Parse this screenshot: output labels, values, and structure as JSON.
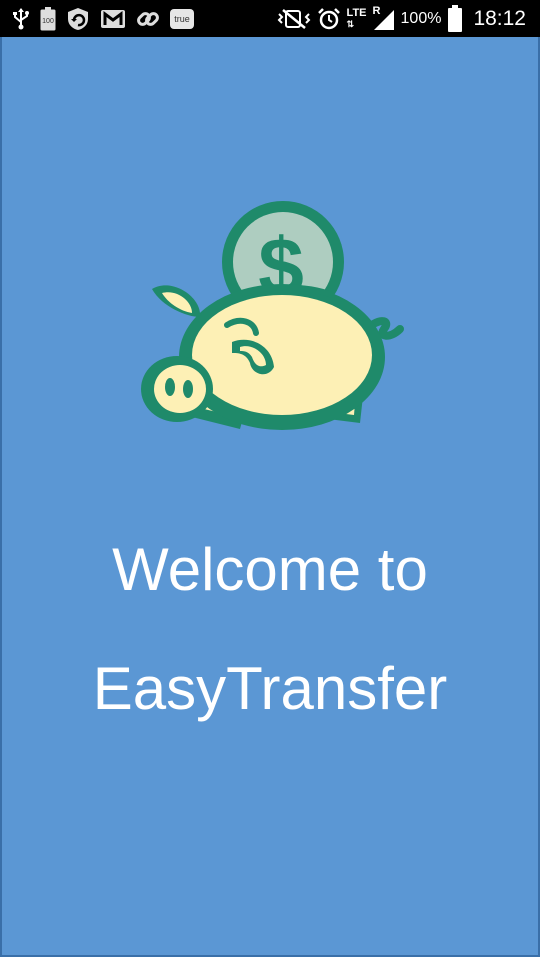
{
  "status_bar": {
    "left_icons": [
      "usb-icon",
      "battery-100-notification-icon",
      "shield-refresh-icon",
      "gmail-icon",
      "link-icon",
      "true-app-icon"
    ],
    "true_badge": "true",
    "hundred_badge": "100",
    "right_icons": [
      "vibrate-mute-icon",
      "alarm-icon",
      "lte-icon",
      "signal-icon",
      "battery-icon"
    ],
    "network": "LTE",
    "roaming": "R",
    "battery_percent": "100%",
    "time": "18:12"
  },
  "app": {
    "background_color": "#5b97d4",
    "logo_icon": "piggy-bank-dollar-icon",
    "welcome_line1": "Welcome to",
    "welcome_line2": "EasyTransfer"
  }
}
